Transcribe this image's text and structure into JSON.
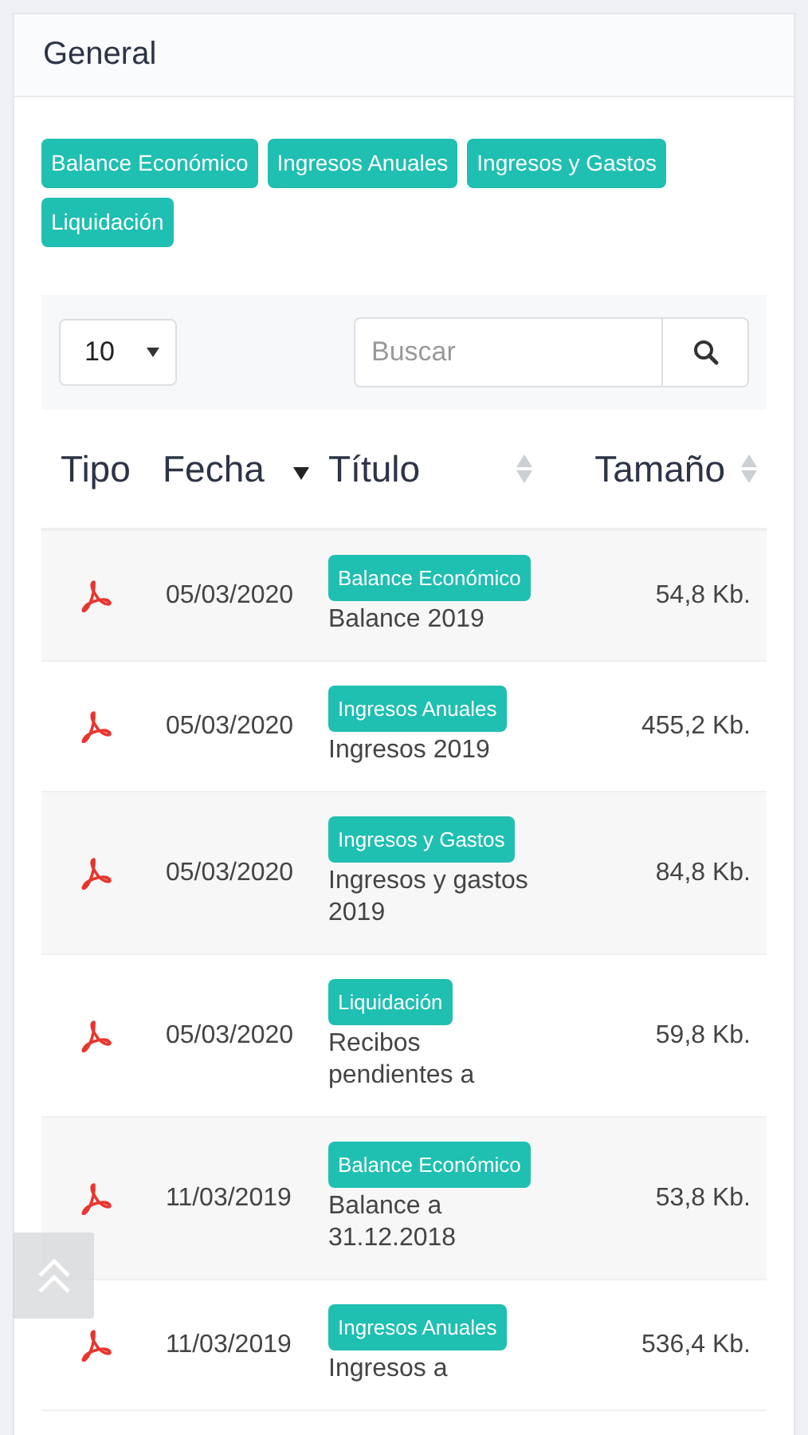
{
  "panel": {
    "title": "General"
  },
  "categories": [
    {
      "label": "Balance Económico"
    },
    {
      "label": "Ingresos Anuales"
    },
    {
      "label": "Ingresos y Gastos"
    },
    {
      "label": "Liquidación"
    }
  ],
  "page_size": {
    "value": "10"
  },
  "search": {
    "placeholder": "Buscar"
  },
  "table": {
    "columns": [
      {
        "label": "Tipo"
      },
      {
        "label": "Fecha",
        "sorted": true
      },
      {
        "label": "Título",
        "sorted": false
      },
      {
        "label": "Tamaño",
        "sorted": false
      }
    ],
    "rows": [
      {
        "date": "05/03/2020",
        "tag": "Balance Económico",
        "title": "Balance 2019",
        "size": "54,8 Kb."
      },
      {
        "date": "05/03/2020",
        "tag": "Ingresos Anuales",
        "title": "Ingresos 2019",
        "size": "455,2 Kb."
      },
      {
        "date": "05/03/2020",
        "tag": "Ingresos y Gastos",
        "title": "Ingresos y gastos 2019",
        "size": "84,8 Kb."
      },
      {
        "date": "05/03/2020",
        "tag": "Liquidación",
        "title": "Recibos pendientes a",
        "size": "59,8 Kb."
      },
      {
        "date": "11/03/2019",
        "tag": "Balance Económico",
        "title": "Balance a 31.12.2018",
        "size": "53,8 Kb."
      },
      {
        "date": "11/03/2019",
        "tag": "Ingresos Anuales",
        "title": "Ingresos a",
        "size": "536,4 Kb."
      }
    ]
  }
}
